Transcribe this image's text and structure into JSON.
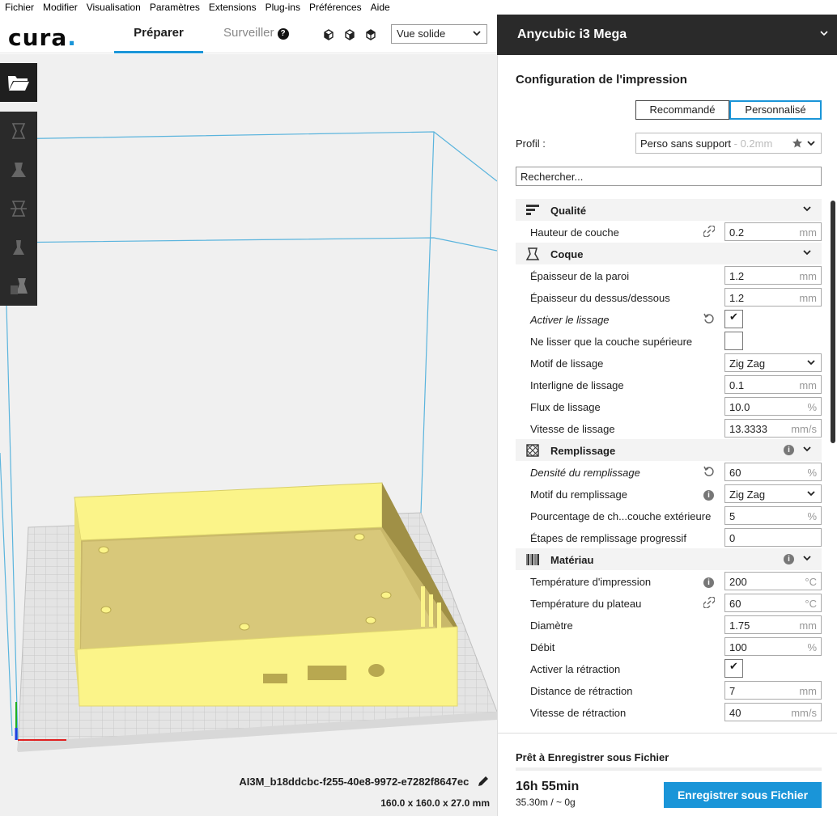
{
  "menu": [
    "Fichier",
    "Modifier",
    "Visualisation",
    "Paramètres",
    "Extensions",
    "Plug-ins",
    "Préférences",
    "Aide"
  ],
  "logo": {
    "text": "cura",
    "dot": "."
  },
  "tabs": {
    "prepare": "Préparer",
    "monitor": "Surveiller"
  },
  "view_select": {
    "value": "Vue solide"
  },
  "printer": {
    "name": "Anycubic i3 Mega"
  },
  "print_setup": {
    "title": "Configuration de l'impression",
    "mode_recommended": "Recommandé",
    "mode_custom": "Personnalisé",
    "profile_label": "Profil :",
    "profile_name": "Perso sans support",
    "profile_layer": " - 0.2mm",
    "search_placeholder": "Rechercher..."
  },
  "categories": {
    "quality": {
      "label": "Qualité",
      "rows": [
        {
          "label": "Hauteur de couche",
          "value": "0.2",
          "unit": "mm"
        }
      ]
    },
    "shell": {
      "label": "Coque",
      "rows": [
        {
          "label": "Épaisseur de la paroi",
          "value": "1.2",
          "unit": "mm"
        },
        {
          "label": "Épaisseur du dessus/dessous",
          "value": "1.2",
          "unit": "mm"
        },
        {
          "label": "Activer le lissage",
          "checked": "✔"
        },
        {
          "label": "Ne lisser que la couche supérieure",
          "checked": ""
        },
        {
          "label": "Motif de lissage",
          "value": "Zig Zag"
        },
        {
          "label": "Interligne de lissage",
          "value": "0.1",
          "unit": "mm"
        },
        {
          "label": "Flux de lissage",
          "value": "10.0",
          "unit": "%"
        },
        {
          "label": "Vitesse de lissage",
          "value": "13.3333",
          "unit": "mm/s"
        }
      ]
    },
    "infill": {
      "label": "Remplissage",
      "rows": [
        {
          "label": "Densité du remplissage",
          "value": "60",
          "unit": "%"
        },
        {
          "label": "Motif du remplissage",
          "value": "Zig Zag"
        },
        {
          "label": "Pourcentage de ch...couche extérieure",
          "value": "5",
          "unit": "%"
        },
        {
          "label": "Étapes de remplissage progressif",
          "value": "0"
        }
      ]
    },
    "material": {
      "label": "Matériau",
      "rows": [
        {
          "label": "Température d'impression",
          "value": "200",
          "unit": "°C"
        },
        {
          "label": "Température du plateau",
          "value": "60",
          "unit": "°C"
        },
        {
          "label": "Diamètre",
          "value": "1.75",
          "unit": "mm"
        },
        {
          "label": "Débit",
          "value": "100",
          "unit": "%"
        },
        {
          "label": "Activer la rétraction",
          "checked": "✔"
        },
        {
          "label": "Distance de rétraction",
          "value": "7",
          "unit": "mm"
        },
        {
          "label": "Vitesse de rétraction",
          "value": "40",
          "unit": "mm/s"
        }
      ]
    }
  },
  "file": {
    "name": "AI3M_b18ddcbc-f255-40e8-9972-e7282f8647ec",
    "dims": "160.0 x 160.0 x 27.0 mm"
  },
  "output": {
    "status": "Prêt à Enregistrer sous Fichier",
    "time": "16h 55min",
    "material": "35.30m / ~ 0g",
    "save_label": "Enregistrer sous Fichier"
  },
  "colors": {
    "accent": "#1a95d8",
    "model": "#fbf489",
    "dark_panel": "#2a2a2a"
  }
}
